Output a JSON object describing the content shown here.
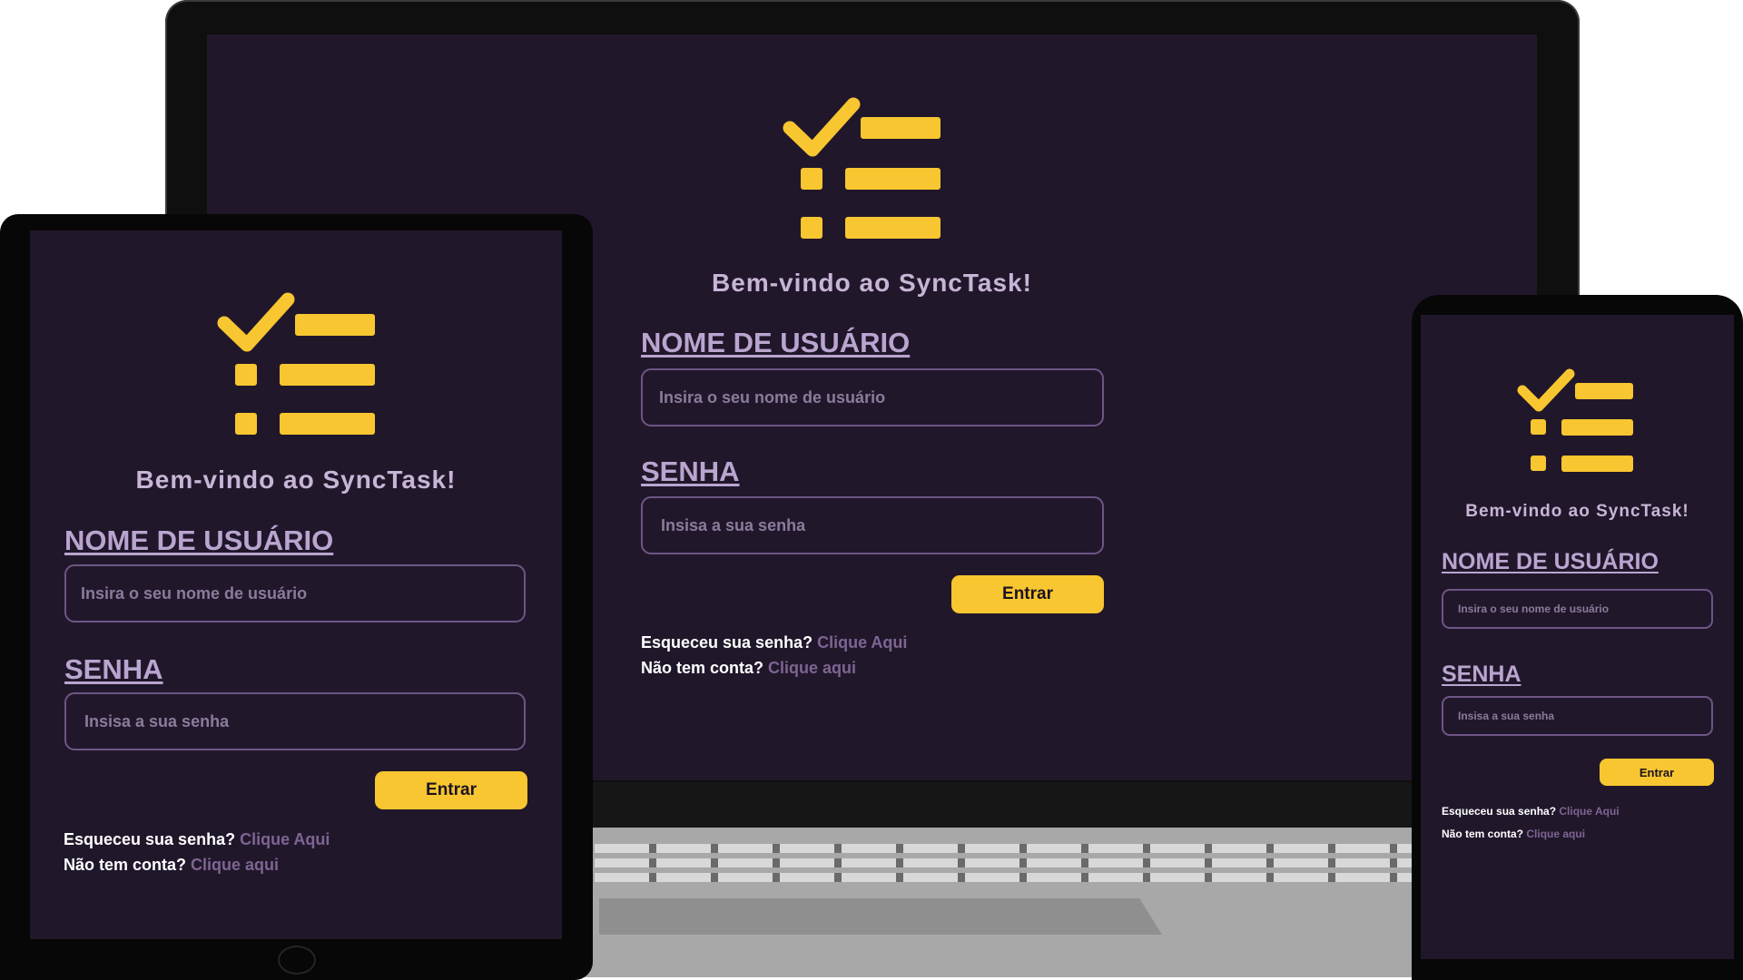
{
  "colors": {
    "screen_bg": "#21172b",
    "accent_yellow": "#f8c630",
    "label_purple": "#b9a5cf",
    "link_purple": "#7d6592",
    "field_border": "#6d5586"
  },
  "logo": {
    "icon": "checklist-icon"
  },
  "login": {
    "welcome": "Bem-vindo ao SyncTask!",
    "username_label": "NOME DE USUÁRIO",
    "username_placeholder": "Insira o seu nome de usuário",
    "password_label": "SENHA",
    "password_placeholder": "Insisa a sua senha",
    "submit_label": "Entrar",
    "forgot_text": "Esqueceu sua senha?",
    "forgot_link_desktop": "Clique Aqui",
    "forgot_link_phone": "Clique Aqui",
    "signup_text": "Não tem conta?",
    "signup_link": "Clique aqui"
  }
}
